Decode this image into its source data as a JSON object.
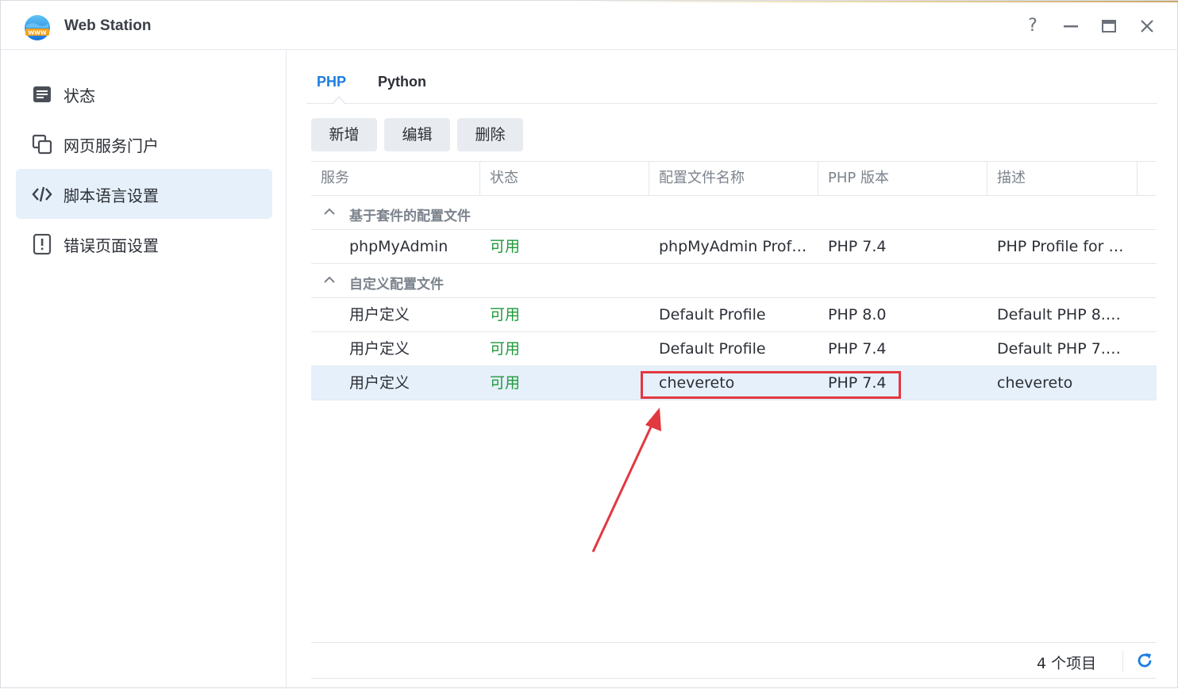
{
  "window": {
    "title": "Web Station",
    "icon": "www-globe-icon",
    "controls": {
      "help": "?",
      "minimize": "—",
      "maximize": "▭",
      "close": "✕"
    }
  },
  "sidebar": {
    "items": [
      {
        "label": "状态",
        "icon": "status-list-icon",
        "active": false
      },
      {
        "label": "网页服务门户",
        "icon": "web-portal-icon",
        "active": false
      },
      {
        "label": "脚本语言设置",
        "icon": "code-icon",
        "active": true
      },
      {
        "label": "错误页面设置",
        "icon": "error-page-icon",
        "active": false
      }
    ]
  },
  "tabs": [
    {
      "label": "PHP",
      "active": true
    },
    {
      "label": "Python",
      "active": false
    }
  ],
  "toolbar": {
    "add_label": "新增",
    "edit_label": "编辑",
    "delete_label": "删除"
  },
  "grid": {
    "columns": [
      "服务",
      "状态",
      "配置文件名称",
      "PHP 版本",
      "描述"
    ],
    "groups": [
      {
        "label": "基于套件的配置文件",
        "rows": [
          {
            "service": "phpMyAdmin",
            "status": "可用",
            "profile": "phpMyAdmin Prof…",
            "version": "PHP 7.4",
            "description": "PHP Profile for …"
          }
        ]
      },
      {
        "label": "自定义配置文件",
        "rows": [
          {
            "service": "用户定义",
            "status": "可用",
            "profile": "Default Profile",
            "version": "PHP 8.0",
            "description": "Default PHP 8.…"
          },
          {
            "service": "用户定义",
            "status": "可用",
            "profile": "Default Profile",
            "version": "PHP 7.4",
            "description": "Default PHP 7.…"
          },
          {
            "service": "用户定义",
            "status": "可用",
            "profile": "chevereto",
            "version": "PHP 7.4",
            "description": "chevereto",
            "selected": true
          }
        ]
      }
    ]
  },
  "footer": {
    "count_label": "4 个项目",
    "refresh_icon": "refresh-icon"
  },
  "colors": {
    "accent": "#1c7ee0",
    "status_ok": "#1f9a3a",
    "selected_row": "#e6f0fb",
    "annotation": "#e2383f"
  }
}
